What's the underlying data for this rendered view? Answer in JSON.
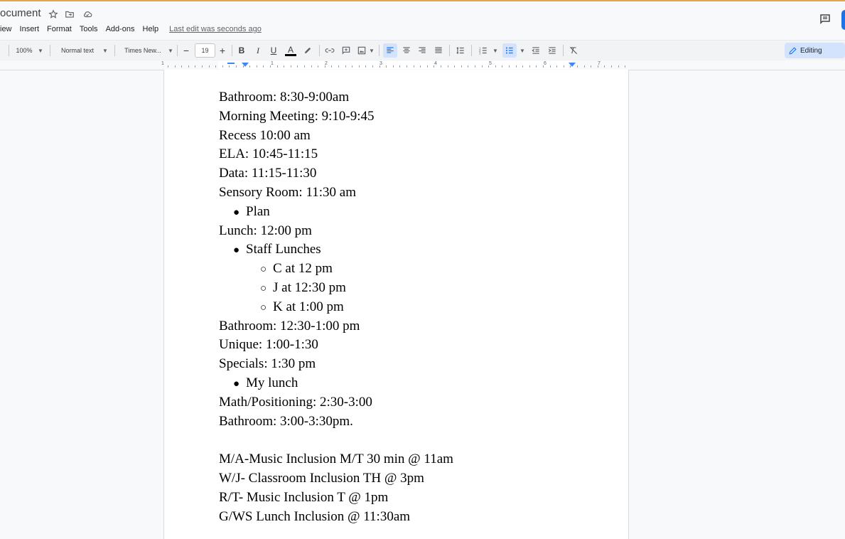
{
  "title_bar": {
    "doc_title": "ocument"
  },
  "menu": {
    "items": [
      "iew",
      "Insert",
      "Format",
      "Tools",
      "Add-ons",
      "Help"
    ],
    "last_edit": "Last edit was seconds ago"
  },
  "toolbar": {
    "zoom": "100%",
    "style": "Normal text",
    "font": "Times New...",
    "font_size": "19",
    "editing_label": "Editing"
  },
  "ruler": {
    "numbers": [
      "1",
      "1",
      "2",
      "3",
      "4",
      "5",
      "6",
      "7"
    ]
  },
  "document": {
    "lines": [
      {
        "text": "Bathroom: 8:30-9:00am",
        "level": 0
      },
      {
        "text": "Morning Meeting: 9:10-9:45",
        "level": 0
      },
      {
        "text": "Recess 10:00 am",
        "level": 0
      },
      {
        "text": "ELA: 10:45-11:15",
        "level": 0
      },
      {
        "text": "Data: 11:15-11:30",
        "level": 0
      },
      {
        "text": "Sensory Room: 11:30 am",
        "level": 0
      },
      {
        "text": "Plan",
        "level": 1,
        "bullet": "●"
      },
      {
        "text": "Lunch: 12:00 pm",
        "level": 0
      },
      {
        "text": "Staff Lunches",
        "level": 1,
        "bullet": "●"
      },
      {
        "text": "C at 12 pm",
        "level": 2,
        "bullet": "○"
      },
      {
        "text": "J at 12:30 pm",
        "level": 2,
        "bullet": "○"
      },
      {
        "text": "K at 1:00 pm",
        "level": 2,
        "bullet": "○"
      },
      {
        "text": "Bathroom: 12:30-1:00 pm",
        "level": 0
      },
      {
        "text": "Unique: 1:00-1:30",
        "level": 0
      },
      {
        "text": "Specials: 1:30 pm",
        "level": 0
      },
      {
        "text": "My lunch",
        "level": 1,
        "bullet": "●"
      },
      {
        "text": "Math/Positioning: 2:30-3:00",
        "level": 0
      },
      {
        "text": "Bathroom: 3:00-3:30pm.",
        "level": 0
      },
      {
        "text": "",
        "level": 0
      },
      {
        "text": "M/A-Music Inclusion M/T 30 min @ 11am",
        "level": 0
      },
      {
        "text": "W/J- Classroom Inclusion TH @ 3pm",
        "level": 0
      },
      {
        "text": "R/T- Music Inclusion T @ 1pm",
        "level": 0
      },
      {
        "text": "G/WS Lunch Inclusion @ 11:30am",
        "level": 0
      }
    ]
  },
  "colors": {
    "accent": "#1a73e8",
    "editing_bg": "#d3e3fd",
    "top_line": "#e0a64a"
  }
}
